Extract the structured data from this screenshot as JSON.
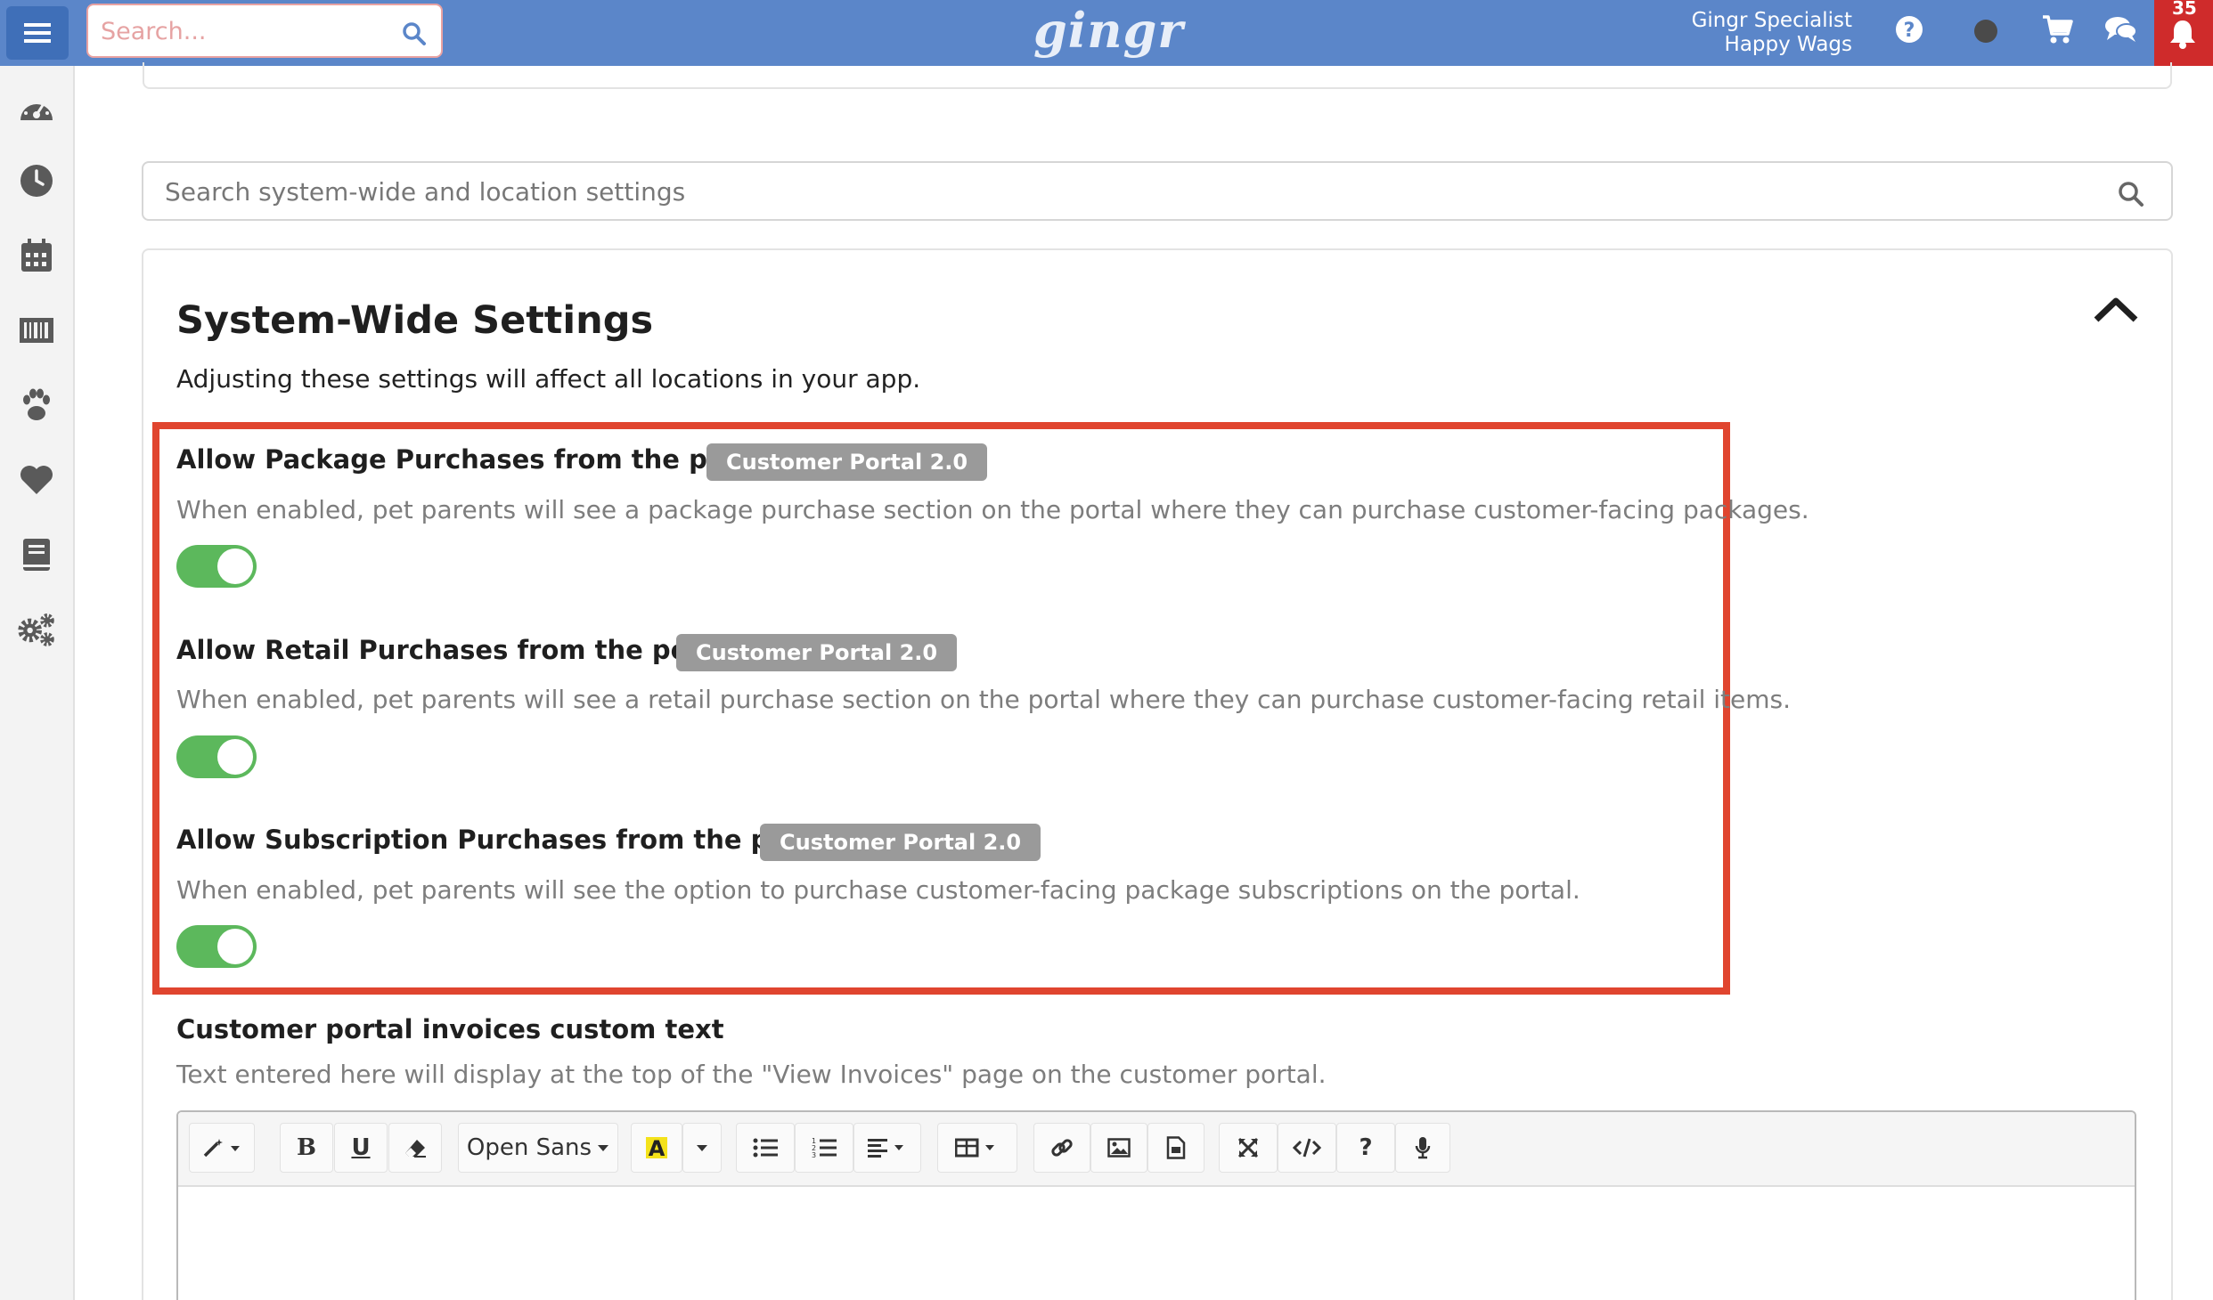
{
  "topbar": {
    "search_placeholder": "Search...",
    "logo": "gingr",
    "user_name": "Gingr Specialist",
    "location": "Happy Wags",
    "notification_count": "35"
  },
  "sidebar": {
    "items": [
      "dashboard-icon",
      "clock-icon",
      "calendar-icon",
      "barcode-icon",
      "paw-icon",
      "heart-icon",
      "book-icon",
      "gears-icon"
    ]
  },
  "settings_search": {
    "placeholder": "Search system-wide and location settings"
  },
  "card": {
    "title": "System-Wide Settings",
    "subtitle": "Adjusting these settings will affect all locations in your app."
  },
  "settings": [
    {
      "label": "Allow Package Purchases from the portal?",
      "badge": "Customer Portal 2.0",
      "description": "When enabled, pet parents will see a package purchase section on the portal where they can purchase customer-facing packages.",
      "enabled": true
    },
    {
      "label": "Allow Retail Purchases from the portal?",
      "badge": "Customer Portal 2.0",
      "description": "When enabled, pet parents will see a retail purchase section on the portal where they can purchase customer-facing retail items.",
      "enabled": true
    },
    {
      "label": "Allow Subscription Purchases from the portal?",
      "badge": "Customer Portal 2.0",
      "description": "When enabled, pet parents will see the option to purchase customer-facing package subscriptions on the portal.",
      "enabled": true
    }
  ],
  "custom_text": {
    "label": "Customer portal invoices custom text",
    "description": "Text entered here will display at the top of the \"View Invoices\" page on the customer portal."
  },
  "editor_toolbar": {
    "font_name": "Open Sans",
    "bold": "B",
    "underline": "U",
    "help": "?"
  },
  "colors": {
    "topbar": "#5b86c9",
    "highlight": "#e0452f",
    "toggle_on": "#5cb85c",
    "badge": "#9a9a9a",
    "notification": "#cf2b2b"
  }
}
